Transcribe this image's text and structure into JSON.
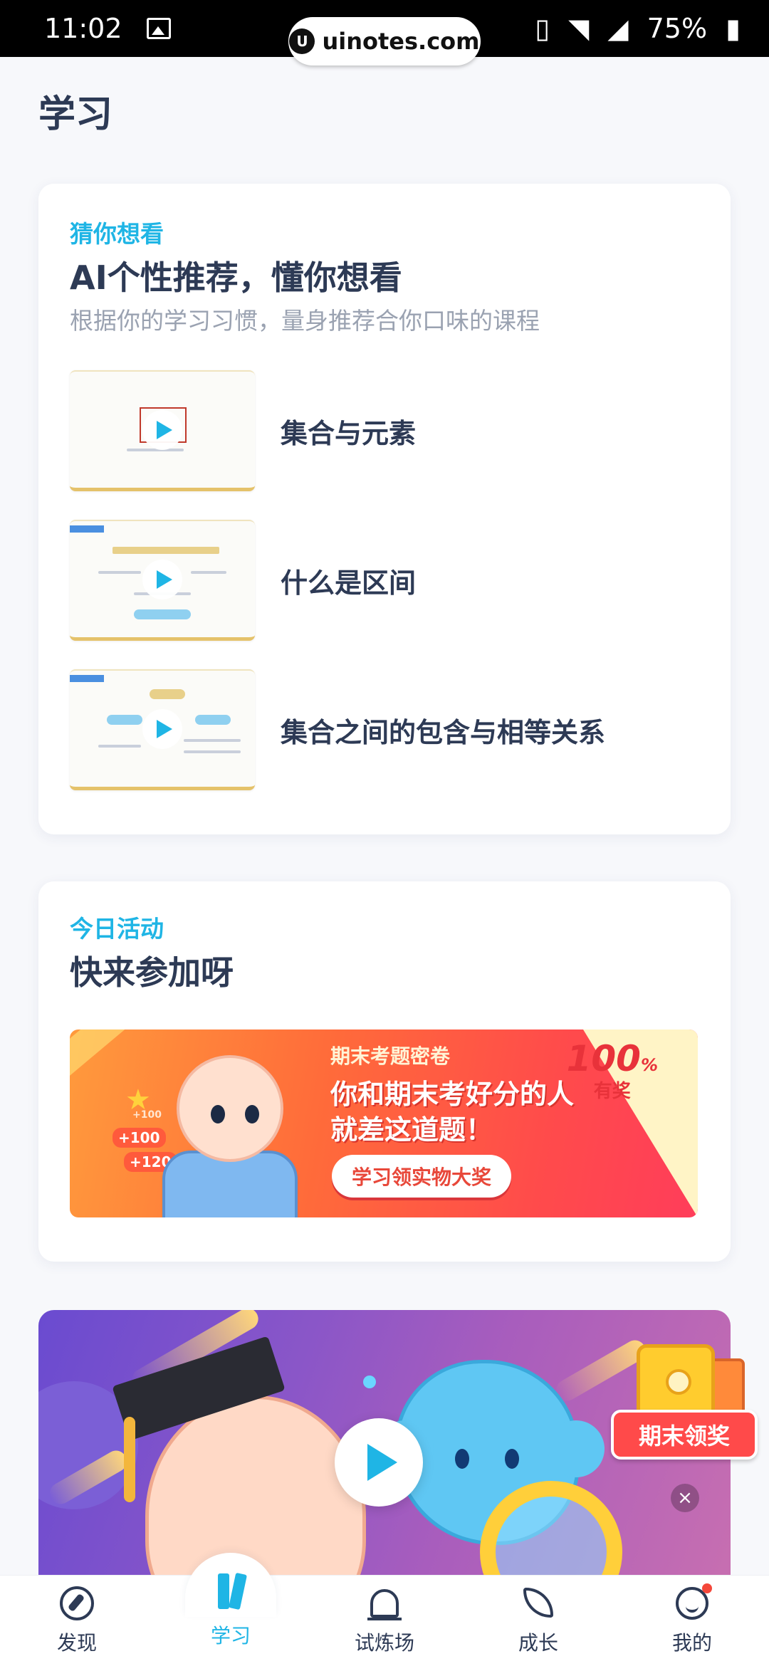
{
  "status_bar": {
    "time": "11:02",
    "url": "uinotes.com",
    "battery": "75%"
  },
  "page": {
    "title": "学习"
  },
  "recommend": {
    "eyebrow": "猜你想看",
    "heading": "AI个性推荐，懂你想看",
    "subtitle": "根据你的学习习惯，量身推荐合你口味的课程",
    "courses": [
      {
        "title": "集合与元素"
      },
      {
        "title": "什么是区间"
      },
      {
        "title": "集合之间的包含与相等关系"
      }
    ]
  },
  "activity": {
    "eyebrow": "今日活动",
    "heading": "快来参加呀",
    "banner": {
      "kicker": "期末考题密卷",
      "line1": "你和期末考好分的人",
      "line2": "就差这道题！",
      "button": "学习领实物大奖",
      "badge_num": "100",
      "badge_unit": "%",
      "badge_sub": "有奖",
      "bonus1": "+100",
      "bonus2": "+100",
      "bonus3": "+120"
    }
  },
  "promo": {
    "label": "期末领奖",
    "close": "×"
  },
  "nav": {
    "items": [
      {
        "label": "发现",
        "icon": "compass-icon"
      },
      {
        "label": "学习",
        "icon": "book-icon"
      },
      {
        "label": "试炼场",
        "icon": "bell-icon"
      },
      {
        "label": "成长",
        "icon": "leaf-icon"
      },
      {
        "label": "我的",
        "icon": "profile-icon"
      }
    ],
    "active_index": 1
  },
  "colors": {
    "accent": "#1fb5e5",
    "text": "#2d3a55",
    "muted": "#9aa2b1",
    "promo_red": "#ff4a4a"
  }
}
